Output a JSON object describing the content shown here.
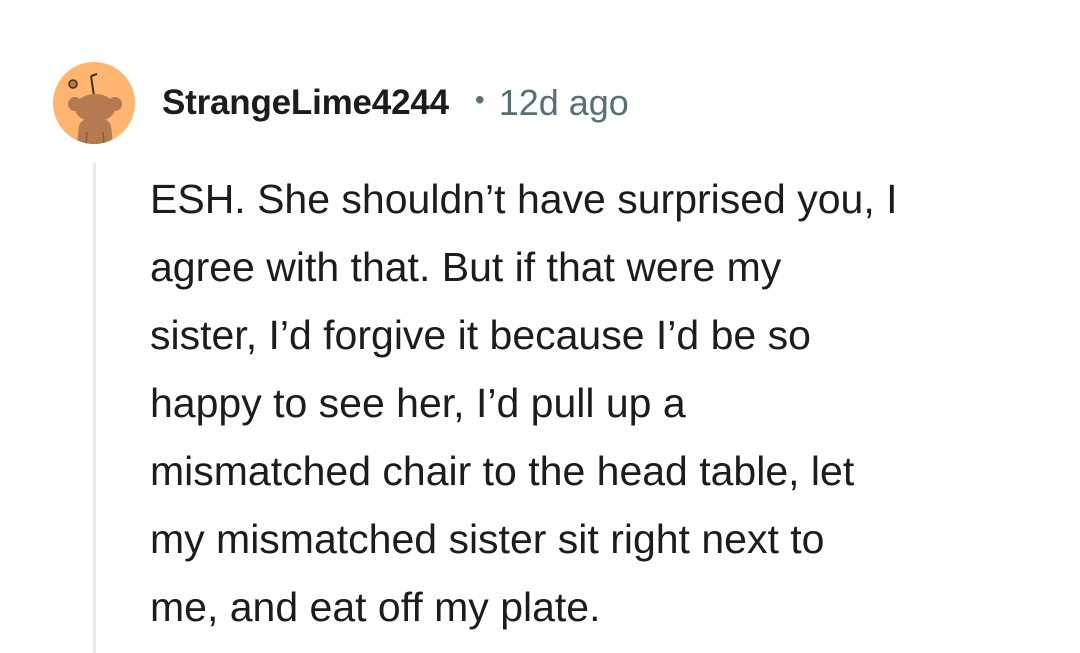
{
  "comment": {
    "author": "StrangeLime4244",
    "separator": "•",
    "age": "12d ago",
    "avatar_icon": "snoo-avatar-icon",
    "avatar_color": "#FFB470",
    "body_lines": [
      "ESH. She shouldn’t have surprised you, I",
      "agree with that. But if that were my",
      "sister, I’d forgive it because I’d be so",
      "happy to see her, I’d pull up a",
      "mismatched chair to the head table, let",
      "my mismatched sister sit right next to",
      "me, and eat off my plate."
    ]
  }
}
